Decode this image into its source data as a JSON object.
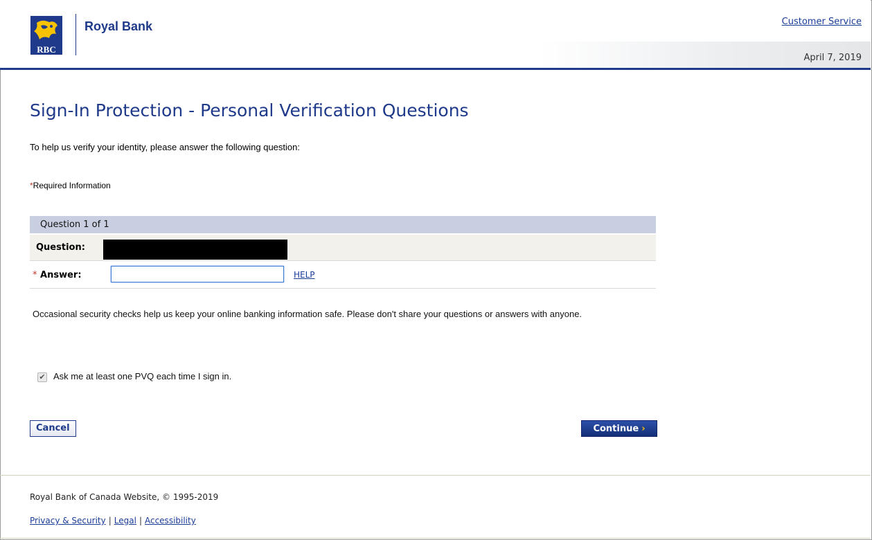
{
  "header": {
    "brand_name": "Royal Bank",
    "logo_text": "RBC",
    "customer_service_link": "Customer Service",
    "date": "April 7, 2019"
  },
  "main": {
    "title": "Sign-In Protection - Personal Verification Questions",
    "intro": "To help us verify your identity, please answer the following question:",
    "required_star": "*",
    "required_text": "Required Information",
    "question_counter": "Question 1 of 1",
    "question_label": "Question:",
    "answer_star": "*",
    "answer_label": "Answer:",
    "answer_value": "",
    "help_link": "HELP",
    "notice": "Occasional security checks help us keep your online banking information safe. Please don't share your questions or answers with anyone.",
    "checkbox_label": "Ask me at least one PVQ each time I sign in.",
    "checkbox_checked": true,
    "cancel_label": "Cancel",
    "continue_label": "Continue",
    "continue_chevron": "›"
  },
  "footer": {
    "copyright": "Royal Bank of Canada Website, © 1995-2019",
    "links": [
      "Privacy & Security",
      "Legal",
      "Accessibility"
    ],
    "separator": "|"
  },
  "colors": {
    "brand_blue": "#1f3a8a",
    "link_blue": "#1a3c99",
    "accent_yellow": "#f7c200",
    "question_header_bg": "#c9cfe0",
    "required_red": "#c0392b"
  }
}
